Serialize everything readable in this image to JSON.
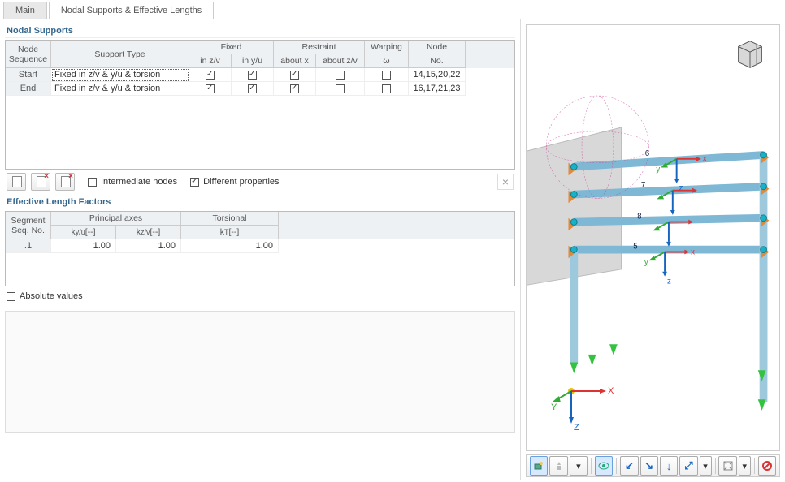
{
  "tabs": {
    "main": "Main",
    "nodal": "Nodal Supports & Effective Lengths"
  },
  "nodal": {
    "title": "Nodal Supports",
    "head": {
      "node_sequence1": "Node",
      "node_sequence2": "Sequence",
      "support_type": "Support Type",
      "fixed": "Fixed",
      "in_zv": "in z/v",
      "in_yu": "in y/u",
      "restraint": "Restraint",
      "about_x": "about x",
      "about_zv": "about z/v",
      "warping": "Warping",
      "omega": "ω",
      "node_no1": "Node",
      "node_no2": "No."
    },
    "rows": [
      {
        "seq": "Start",
        "type": "Fixed in z/v & y/u & torsion",
        "inzv": true,
        "inyu": true,
        "aboutx": true,
        "aboutzv": false,
        "omega": false,
        "nodeno": "14,15,20,22"
      },
      {
        "seq": "End",
        "type": "Fixed in z/v & y/u & torsion",
        "inzv": true,
        "inyu": true,
        "aboutx": true,
        "aboutzv": false,
        "omega": false,
        "nodeno": "16,17,21,23"
      }
    ],
    "intermediate_nodes": "Intermediate nodes",
    "different_properties": "Different properties",
    "different_properties_on": true
  },
  "el": {
    "title": "Effective Length Factors",
    "head": {
      "seg1": "Segment",
      "seg2": "Seq. No.",
      "principal": "Principal axes",
      "kyu": "ky/u [-.-]",
      "kzv": "kz/v [-.-]",
      "torsional": "Torsional",
      "kt": "kT [-.-]"
    },
    "rows": [
      {
        "seq": ".1",
        "kyu": "1.00",
        "kzv": "1.00",
        "kt": "1.00"
      }
    ],
    "absolute_values": "Absolute values"
  },
  "viewport": {
    "axes": {
      "x": "X",
      "y": "Y",
      "z": "Z"
    },
    "local_axes": {
      "x": "x",
      "y": "y",
      "z": "z"
    },
    "member_labels": [
      "5",
      "6",
      "7",
      "8"
    ],
    "toolbar_icons": [
      "view-camera",
      "view-trophy",
      "print",
      "eye",
      "axes-xy",
      "axes-yz",
      "axes-zx",
      "axes-3d",
      "fit",
      "dropdown",
      "zoom-extents",
      "cancel"
    ]
  }
}
